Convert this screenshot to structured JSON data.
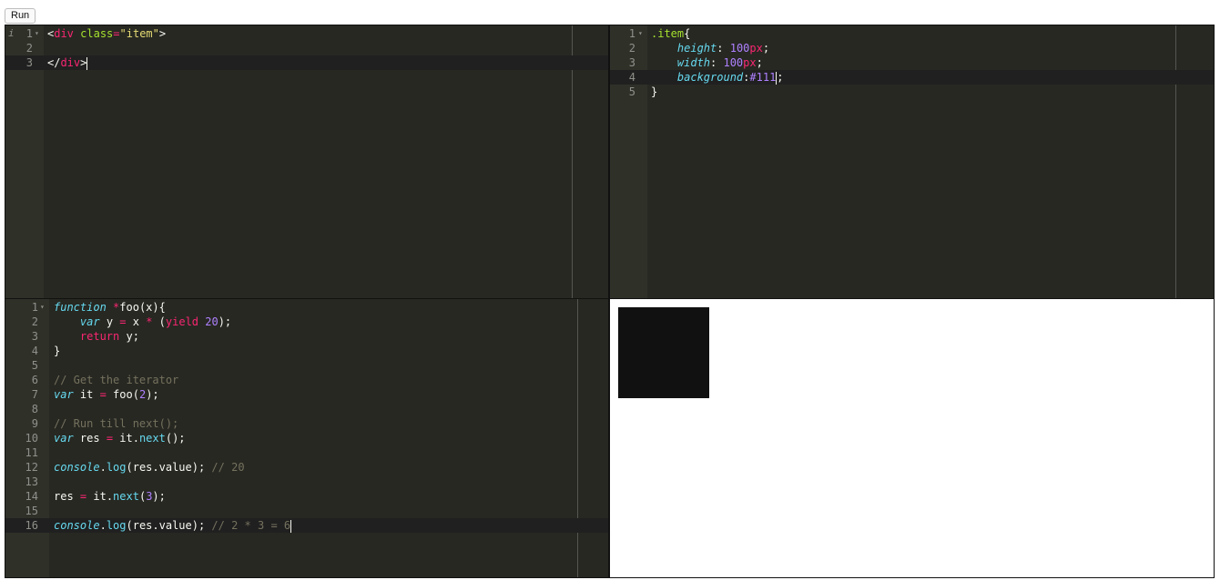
{
  "toolbar": {
    "run_label": "Run"
  },
  "panes": {
    "html": {
      "language": "html",
      "info_marker": "i",
      "active_line": 3,
      "lines": [
        {
          "n": "1",
          "fold": true,
          "tokens": [
            {
              "t": "<",
              "c": "t-plain"
            },
            {
              "t": "div",
              "c": "t-tag"
            },
            {
              "t": " ",
              "c": "t-plain"
            },
            {
              "t": "class",
              "c": "t-attr"
            },
            {
              "t": "=",
              "c": "t-kw"
            },
            {
              "t": "\"item\"",
              "c": "t-str"
            },
            {
              "t": ">",
              "c": "t-plain"
            }
          ]
        },
        {
          "n": "2",
          "fold": false,
          "tokens": []
        },
        {
          "n": "3",
          "fold": false,
          "tokens": [
            {
              "t": "</",
              "c": "t-plain"
            },
            {
              "t": "div",
              "c": "t-tag"
            },
            {
              "t": ">",
              "c": "t-plain"
            }
          ],
          "cursor": true
        }
      ]
    },
    "css": {
      "language": "css",
      "active_line": 4,
      "lines": [
        {
          "n": "1",
          "fold": true,
          "tokens": [
            {
              "t": ".item",
              "c": "t-cls"
            },
            {
              "t": "{",
              "c": "t-plain"
            }
          ]
        },
        {
          "n": "2",
          "fold": false,
          "tokens": [
            {
              "t": "    ",
              "c": "t-plain"
            },
            {
              "t": "height",
              "c": "t-prop"
            },
            {
              "t": ": ",
              "c": "t-plain"
            },
            {
              "t": "100",
              "c": "t-num"
            },
            {
              "t": "px",
              "c": "t-unit"
            },
            {
              "t": ";",
              "c": "t-plain"
            }
          ]
        },
        {
          "n": "3",
          "fold": false,
          "tokens": [
            {
              "t": "    ",
              "c": "t-plain"
            },
            {
              "t": "width",
              "c": "t-prop"
            },
            {
              "t": ": ",
              "c": "t-plain"
            },
            {
              "t": "100",
              "c": "t-num"
            },
            {
              "t": "px",
              "c": "t-unit"
            },
            {
              "t": ";",
              "c": "t-plain"
            }
          ]
        },
        {
          "n": "4",
          "fold": false,
          "tokens": [
            {
              "t": "    ",
              "c": "t-plain"
            },
            {
              "t": "background",
              "c": "t-prop"
            },
            {
              "t": ":",
              "c": "t-plain"
            },
            {
              "t": "#111",
              "c": "t-const"
            }
          ],
          "cursor": true,
          "after": [
            {
              "t": ";",
              "c": "t-plain"
            }
          ]
        },
        {
          "n": "5",
          "fold": false,
          "tokens": [
            {
              "t": "}",
              "c": "t-plain"
            }
          ]
        }
      ]
    },
    "js": {
      "language": "javascript",
      "active_line": 16,
      "lines": [
        {
          "n": "1",
          "fold": true,
          "tokens": [
            {
              "t": "function",
              "c": "t-store"
            },
            {
              "t": " ",
              "c": "t-plain"
            },
            {
              "t": "*",
              "c": "t-kw"
            },
            {
              "t": "foo(x){",
              "c": "t-plain"
            }
          ]
        },
        {
          "n": "2",
          "fold": false,
          "tokens": [
            {
              "t": "    ",
              "c": "t-plain"
            },
            {
              "t": "var",
              "c": "t-store"
            },
            {
              "t": " y ",
              "c": "t-plain"
            },
            {
              "t": "=",
              "c": "t-kw"
            },
            {
              "t": " x ",
              "c": "t-plain"
            },
            {
              "t": "*",
              "c": "t-kw"
            },
            {
              "t": " (",
              "c": "t-plain"
            },
            {
              "t": "yield",
              "c": "t-kw"
            },
            {
              "t": " ",
              "c": "t-plain"
            },
            {
              "t": "20",
              "c": "t-num"
            },
            {
              "t": ");",
              "c": "t-plain"
            }
          ]
        },
        {
          "n": "3",
          "fold": false,
          "tokens": [
            {
              "t": "    ",
              "c": "t-plain"
            },
            {
              "t": "return",
              "c": "t-kw"
            },
            {
              "t": " y;",
              "c": "t-plain"
            }
          ]
        },
        {
          "n": "4",
          "fold": false,
          "tokens": [
            {
              "t": "}",
              "c": "t-plain"
            }
          ]
        },
        {
          "n": "5",
          "fold": false,
          "tokens": []
        },
        {
          "n": "6",
          "fold": false,
          "tokens": [
            {
              "t": "// Get the iterator",
              "c": "t-cmt"
            }
          ]
        },
        {
          "n": "7",
          "fold": false,
          "tokens": [
            {
              "t": "var",
              "c": "t-store"
            },
            {
              "t": " it ",
              "c": "t-plain"
            },
            {
              "t": "=",
              "c": "t-kw"
            },
            {
              "t": " foo(",
              "c": "t-plain"
            },
            {
              "t": "2",
              "c": "t-num"
            },
            {
              "t": ");",
              "c": "t-plain"
            }
          ]
        },
        {
          "n": "8",
          "fold": false,
          "tokens": []
        },
        {
          "n": "9",
          "fold": false,
          "tokens": [
            {
              "t": "// Run till next();",
              "c": "t-cmt"
            }
          ]
        },
        {
          "n": "10",
          "fold": false,
          "tokens": [
            {
              "t": "var",
              "c": "t-store"
            },
            {
              "t": " res ",
              "c": "t-plain"
            },
            {
              "t": "=",
              "c": "t-kw"
            },
            {
              "t": " it.",
              "c": "t-plain"
            },
            {
              "t": "next",
              "c": "t-fn"
            },
            {
              "t": "();",
              "c": "t-plain"
            }
          ]
        },
        {
          "n": "11",
          "fold": false,
          "tokens": []
        },
        {
          "n": "12",
          "fold": false,
          "tokens": [
            {
              "t": "console",
              "c": "t-store"
            },
            {
              "t": ".",
              "c": "t-plain"
            },
            {
              "t": "log",
              "c": "t-fn"
            },
            {
              "t": "(res.value); ",
              "c": "t-plain"
            },
            {
              "t": "// 20",
              "c": "t-cmt"
            }
          ]
        },
        {
          "n": "13",
          "fold": false,
          "tokens": []
        },
        {
          "n": "14",
          "fold": false,
          "tokens": [
            {
              "t": "res ",
              "c": "t-plain"
            },
            {
              "t": "=",
              "c": "t-kw"
            },
            {
              "t": " it.",
              "c": "t-plain"
            },
            {
              "t": "next",
              "c": "t-fn"
            },
            {
              "t": "(",
              "c": "t-plain"
            },
            {
              "t": "3",
              "c": "t-num"
            },
            {
              "t": ");",
              "c": "t-plain"
            }
          ]
        },
        {
          "n": "15",
          "fold": false,
          "tokens": []
        },
        {
          "n": "16",
          "fold": false,
          "tokens": [
            {
              "t": "console",
              "c": "t-store"
            },
            {
              "t": ".",
              "c": "t-plain"
            },
            {
              "t": "log",
              "c": "t-fn"
            },
            {
              "t": "(res.value); ",
              "c": "t-plain"
            },
            {
              "t": "// 2 * 3 = 6",
              "c": "t-cmt"
            }
          ],
          "cursor": true
        }
      ]
    }
  },
  "output": {
    "item_color": "#111111"
  },
  "theme": {
    "editor_bg": "#272822",
    "gutter_bg": "#2F3129",
    "active_line_bg": "#202020"
  }
}
